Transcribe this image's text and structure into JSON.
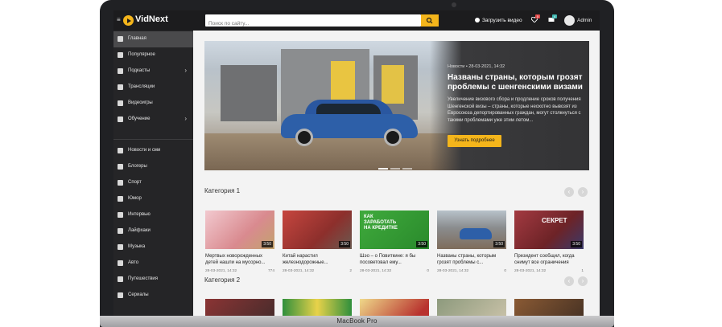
{
  "app": {
    "title": "VidNext"
  },
  "search": {
    "placeholder": "Поиск по сайту..."
  },
  "header": {
    "upload_label": "Загрузить видео",
    "notif_count": "5",
    "msg_count": "4",
    "user": "Admin"
  },
  "sidebar": {
    "items": [
      {
        "label": "Главная",
        "icon": "home-icon"
      },
      {
        "label": "Популярное",
        "icon": "star-icon"
      },
      {
        "label": "Подкасты",
        "icon": "podcast-icon"
      },
      {
        "label": "Трансляции",
        "icon": "monitor-icon"
      },
      {
        "label": "Видеоигры",
        "icon": "gamepad-icon"
      },
      {
        "label": "Обучение",
        "icon": "graduation-icon"
      },
      {
        "label": "Новости и сми",
        "icon": "globe-icon"
      },
      {
        "label": "Блогеры",
        "icon": "users-icon"
      },
      {
        "label": "Спорт",
        "icon": "ball-icon"
      },
      {
        "label": "Юмор",
        "icon": "smile-icon"
      },
      {
        "label": "Интервью",
        "icon": "microphone-icon"
      },
      {
        "label": "Лайфхаки",
        "icon": "thumbs-up-icon"
      },
      {
        "label": "Музыка",
        "icon": "music-icon"
      },
      {
        "label": "Авто",
        "icon": "car-icon"
      },
      {
        "label": "Путешествия",
        "icon": "plane-icon"
      },
      {
        "label": "Сериалы",
        "icon": "film-icon"
      }
    ]
  },
  "hero": {
    "meta": "Новости • 28-03-2021, 14:32",
    "title": "Названы страны, которым грозят проблемы с шенгенскими визами",
    "desc": "Увеличение визового сбора и продление сроков получения Шенгенской визы – страны, которые неохотно вывозят из Евросоюза депортированных граждан, могут столкнуться с такими проблемами уже этим летом...",
    "button": "Узнать подробнее"
  },
  "category1": {
    "title": "Категория 1",
    "cards": [
      {
        "title": "Мертвых новорожденных детей нашли на мусорно...",
        "date": "28-03-2021, 14:32",
        "views": "774",
        "duration": "3:50",
        "thumb_color": "#e8a9b0"
      },
      {
        "title": "Китай нарастил железнодорожные...",
        "date": "28-03-2021, 14:32",
        "views": "2",
        "duration": "3:50",
        "thumb_color": "#b8423c"
      },
      {
        "title": "Шэо – о Повиткине: я бы посоветовал ему...",
        "date": "28-03-2021, 14:32",
        "views": "0",
        "duration": "3:50",
        "thumb_color": "#3aa23a",
        "thumb_caption": "КАК ЗАРАБОТАТЬ НА КРЕДИТКЕ"
      },
      {
        "title": "Названы страны, которым грозят проблемы с...",
        "date": "28-03-2021, 14:32",
        "views": "0",
        "duration": "3:50",
        "thumb_color": "#7f8c94"
      },
      {
        "title": "Президент сообщил, когда снимут все ограничения",
        "date": "28-03-2021, 14:32",
        "views": "1",
        "duration": "3:50",
        "thumb_color": "#9b2f37",
        "thumb_caption": "СЕКРЕТ"
      }
    ]
  },
  "category2": {
    "title": "Категория 2",
    "thumbs": [
      "#6f2e2e",
      "#2f8f3c",
      "#e9d37a",
      "#7d8a70",
      "#7a5030"
    ]
  },
  "device": {
    "label": "MacBook Pro"
  }
}
